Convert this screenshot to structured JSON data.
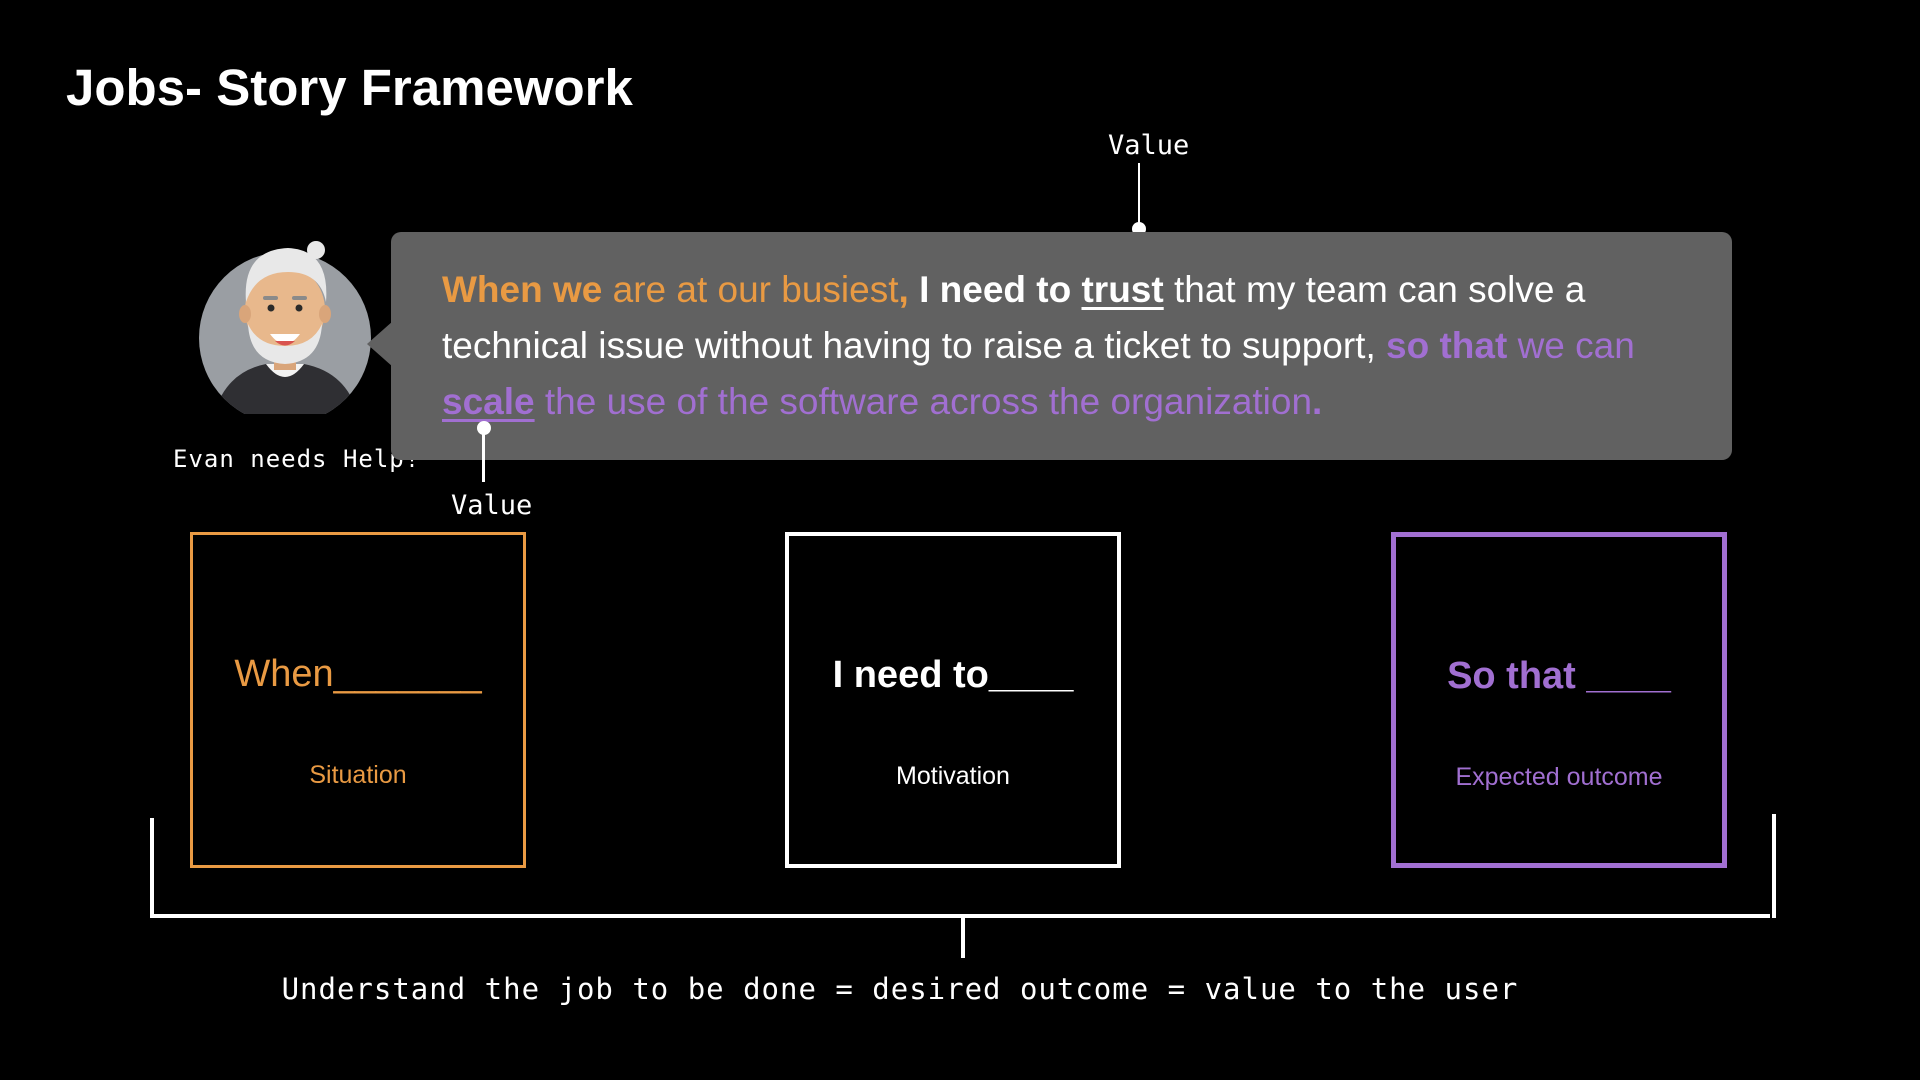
{
  "header": {
    "title_bold": "Jobs-",
    "title_rest": " Story Framework"
  },
  "annotations": {
    "top_value_label": "Value",
    "bottom_value_label": "Value"
  },
  "persona": {
    "caption": "Evan needs Help!"
  },
  "story": {
    "p1": "When we",
    "p2": " are at our busiest",
    "p3": ",",
    "p4": " I need to ",
    "p5": "trust",
    "p6": " that my team can solve a technical issue without having to raise a ticket to support, ",
    "p7": "so that",
    "p8": " we can ",
    "p9": "scale",
    "p10": " the use of the software across the organization",
    "p11": "."
  },
  "boxes": [
    {
      "title": "When_______",
      "subtitle": "Situation",
      "color": "#e99a43"
    },
    {
      "title": "I need to____",
      "subtitle": "Motivation",
      "color": "#ffffff"
    },
    {
      "title": "So that ____",
      "subtitle": "Expected outcome",
      "color": "#a16fd1"
    }
  ],
  "footer": {
    "text": "Understand the job to be done = desired outcome = value to the user"
  },
  "colors": {
    "background": "#000000",
    "bubble": "#616161",
    "orange": "#e99a43",
    "purple": "#a16fd1"
  }
}
